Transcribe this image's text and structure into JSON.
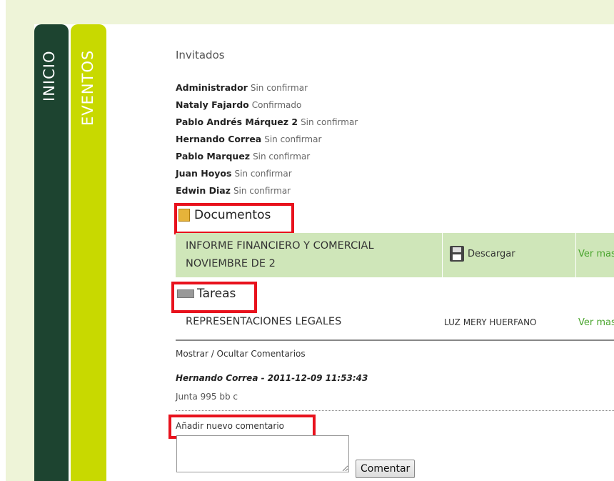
{
  "nav": {
    "tab_inicio": "INICIO",
    "tab_eventos": "EVENTOS"
  },
  "guests_section": {
    "title": "Invitados",
    "guests": [
      {
        "name": "Administrador",
        "status": "Sin confirmar"
      },
      {
        "name": "Nataly Fajardo",
        "status": "Confirmado"
      },
      {
        "name": "Pablo Andrés Márquez 2",
        "status": "Sin confirmar"
      },
      {
        "name": "Hernando Correa",
        "status": "Sin confirmar"
      },
      {
        "name": "Pablo Marquez",
        "status": "Sin confirmar"
      },
      {
        "name": "Juan Hoyos",
        "status": "Sin confirmar"
      },
      {
        "name": "Edwin Diaz",
        "status": "Sin confirmar"
      }
    ]
  },
  "documents": {
    "heading": "Documentos",
    "icon": "folder-icon",
    "item": {
      "title_line1": "INFORME FINANCIERO Y COMERCIAL",
      "title_line2": "NOVIEMBRE DE 2",
      "download_label": "Descargar",
      "more_label": "Ver mas"
    }
  },
  "tasks": {
    "heading": "Tareas",
    "icon": "task-icon",
    "item": {
      "title": "REPRESENTACIONES LEGALES",
      "assignee": "LUZ MERY HUERFANO",
      "more_label": "Ver mas"
    }
  },
  "comments": {
    "toggle_label": "Mostrar / Ocultar Comentarios",
    "entries": [
      {
        "author_date": "Hernando Correa - 2011-12-09 11:53:43",
        "text": "Junta 995 bb c"
      }
    ],
    "add_label": "Añadir nuevo comentario",
    "input_value": "",
    "submit_label": "Comentar"
  },
  "colors": {
    "highlight": "#e8121d",
    "inicio_tab": "#1d4430",
    "eventos_tab": "#c8d900",
    "row_bg": "#cfe6b9",
    "link": "#4aa52e"
  }
}
